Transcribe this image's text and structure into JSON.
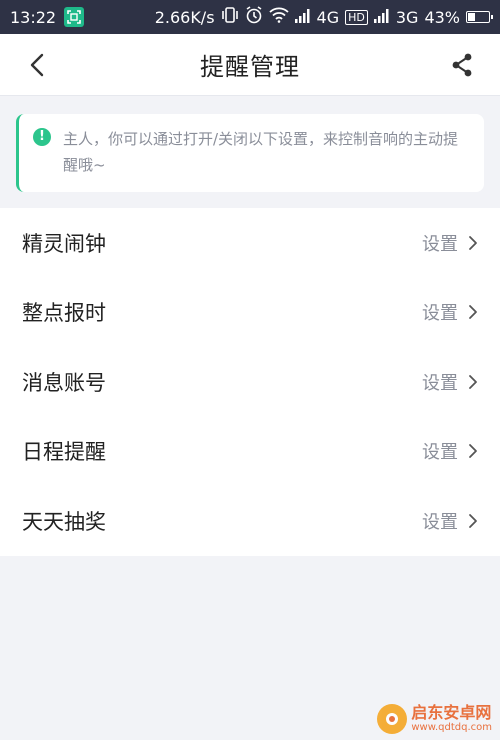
{
  "status_bar": {
    "time": "13:22",
    "speed": "2.66K/s",
    "network1": "4G",
    "hd_badge": "HD",
    "network2": "3G",
    "battery": "43%",
    "battery_level": 0.43
  },
  "header": {
    "title": "提醒管理"
  },
  "notice": {
    "text": "主人，你可以通过打开/关闭以下设置，来控制音响的主动提醒哦~"
  },
  "list": {
    "items": [
      {
        "label": "精灵闹钟",
        "action": "设置"
      },
      {
        "label": "整点报时",
        "action": "设置"
      },
      {
        "label": "消息账号",
        "action": "设置"
      },
      {
        "label": "日程提醒",
        "action": "设置"
      },
      {
        "label": "天天抽奖",
        "action": "设置"
      }
    ]
  },
  "watermark": {
    "title": "启东安卓网",
    "url": "www.qdtdq.com"
  },
  "colors": {
    "accent": "#2cc58c",
    "status_bar": "#2e3245",
    "background": "#f2f3f7"
  }
}
